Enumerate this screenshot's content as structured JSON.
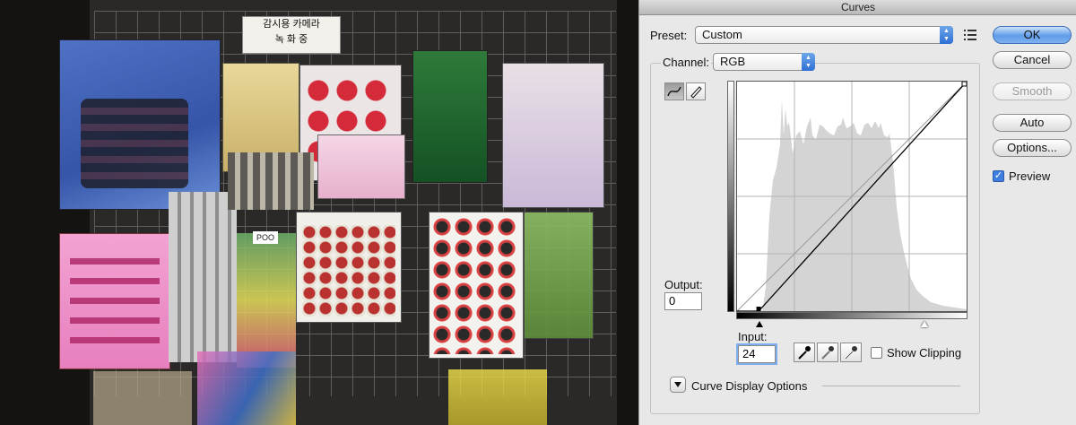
{
  "dialog": {
    "title": "Curves",
    "preset_label": "Preset:",
    "preset_value": "Custom",
    "channel_label": "Channel:",
    "channel_value": "RGB",
    "buttons": {
      "ok": "OK",
      "cancel": "Cancel",
      "smooth": "Smooth",
      "auto": "Auto",
      "options": "Options..."
    },
    "preview_label": "Preview",
    "preview_checked": true,
    "output_label": "Output:",
    "output_value": "0",
    "input_label": "Input:",
    "input_value": "24",
    "show_clipping_label": "Show Clipping",
    "show_clipping_checked": false,
    "curve_display_options_label": "Curve Display Options",
    "curve_points": [
      [
        24,
        0
      ],
      [
        255,
        255
      ]
    ],
    "accent_color": "#3f7ee0"
  },
  "photo": {
    "sign_line1": "감시용 카메라",
    "sign_line2": "녹 화 중",
    "poo_tag": "POO"
  },
  "icons": {
    "preset_menu": "list-menu-icon",
    "curve_tool": "curve-tool-icon",
    "pencil_tool": "pencil-tool-icon",
    "black_eyedropper": "black-point-eyedropper-icon",
    "gray_eyedropper": "gray-point-eyedropper-icon",
    "white_eyedropper": "white-point-eyedropper-icon",
    "disclosure": "disclosure-triangle-icon"
  }
}
